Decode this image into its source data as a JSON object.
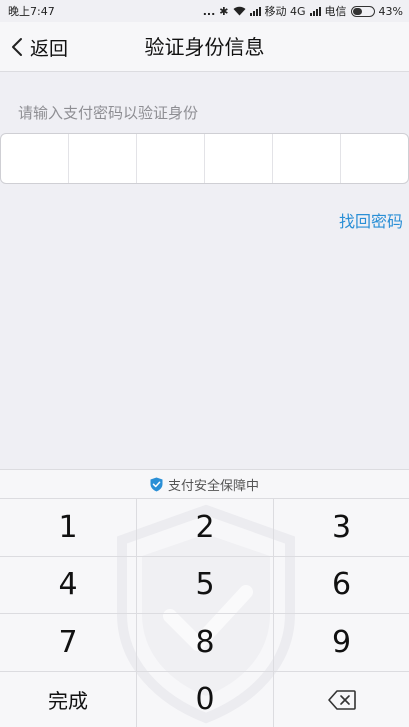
{
  "status_bar": {
    "time": "晚上7:47",
    "dots": "...",
    "carrier1": "移动 4G",
    "carrier2": "电信",
    "battery_percent": 43,
    "battery_label": "43%"
  },
  "header": {
    "back_label": "返回",
    "title": "验证身份信息"
  },
  "content": {
    "hint": "请输入支付密码以验证身份",
    "password_length": 6,
    "forgot_link": "找回密码"
  },
  "keyboard": {
    "secure_text": "支付安全保障中",
    "keys": [
      "1",
      "2",
      "3",
      "4",
      "5",
      "6",
      "7",
      "8",
      "9",
      "完成",
      "0",
      ""
    ],
    "accent_color": "#2a8fd6"
  }
}
